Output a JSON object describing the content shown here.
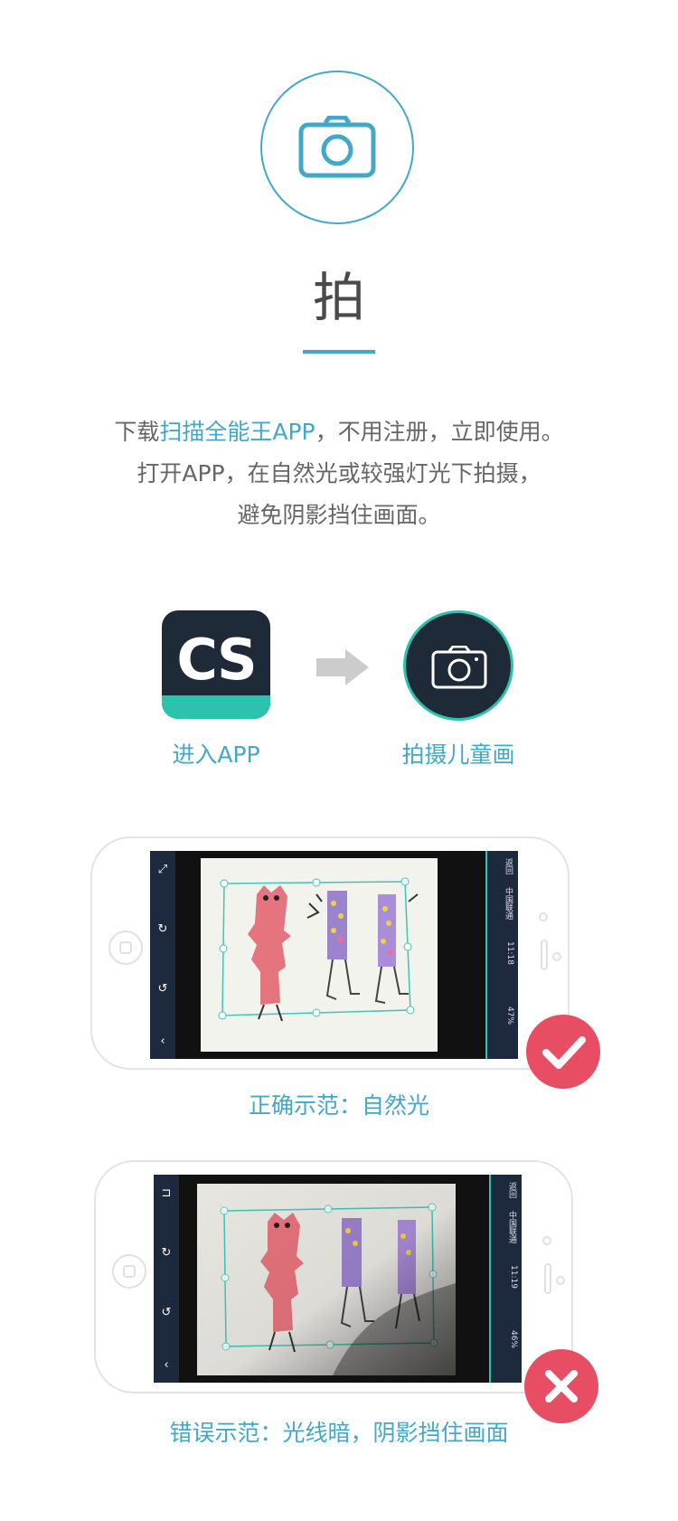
{
  "header": {
    "title": "拍"
  },
  "description": {
    "line1_prefix": "下载",
    "line1_app": "扫描全能王APP",
    "line1_suffix": "，不用注册，立即使用。",
    "line2": "打开APP，在自然光或较强灯光下拍摄，",
    "line3": "避免阴影挡住画面。"
  },
  "steps": {
    "app_icon_text": "CS",
    "step1_label": "进入APP",
    "step2_label": "拍摄儿童画"
  },
  "examples": {
    "good_caption": "正确示范：自然光",
    "bad_caption": "错误示范：光线暗，阴影挡住画面",
    "good_status": {
      "back": "返回",
      "carrier": "中国联通",
      "time": "11:18",
      "battery": "47%"
    },
    "bad_status": {
      "back": "返回",
      "carrier": "中国联通",
      "time": "11:19",
      "battery": "46%"
    }
  },
  "colors": {
    "accent": "#43a8c8",
    "dark": "#1e2a38",
    "teal": "#2bc3ad",
    "ok_badge": "#e74e63",
    "error_badge": "#e74e63"
  },
  "icons": {
    "header": "camera-icon",
    "arrow": "arrow-right-icon",
    "good": "checkmark-icon",
    "bad": "cross-icon"
  }
}
